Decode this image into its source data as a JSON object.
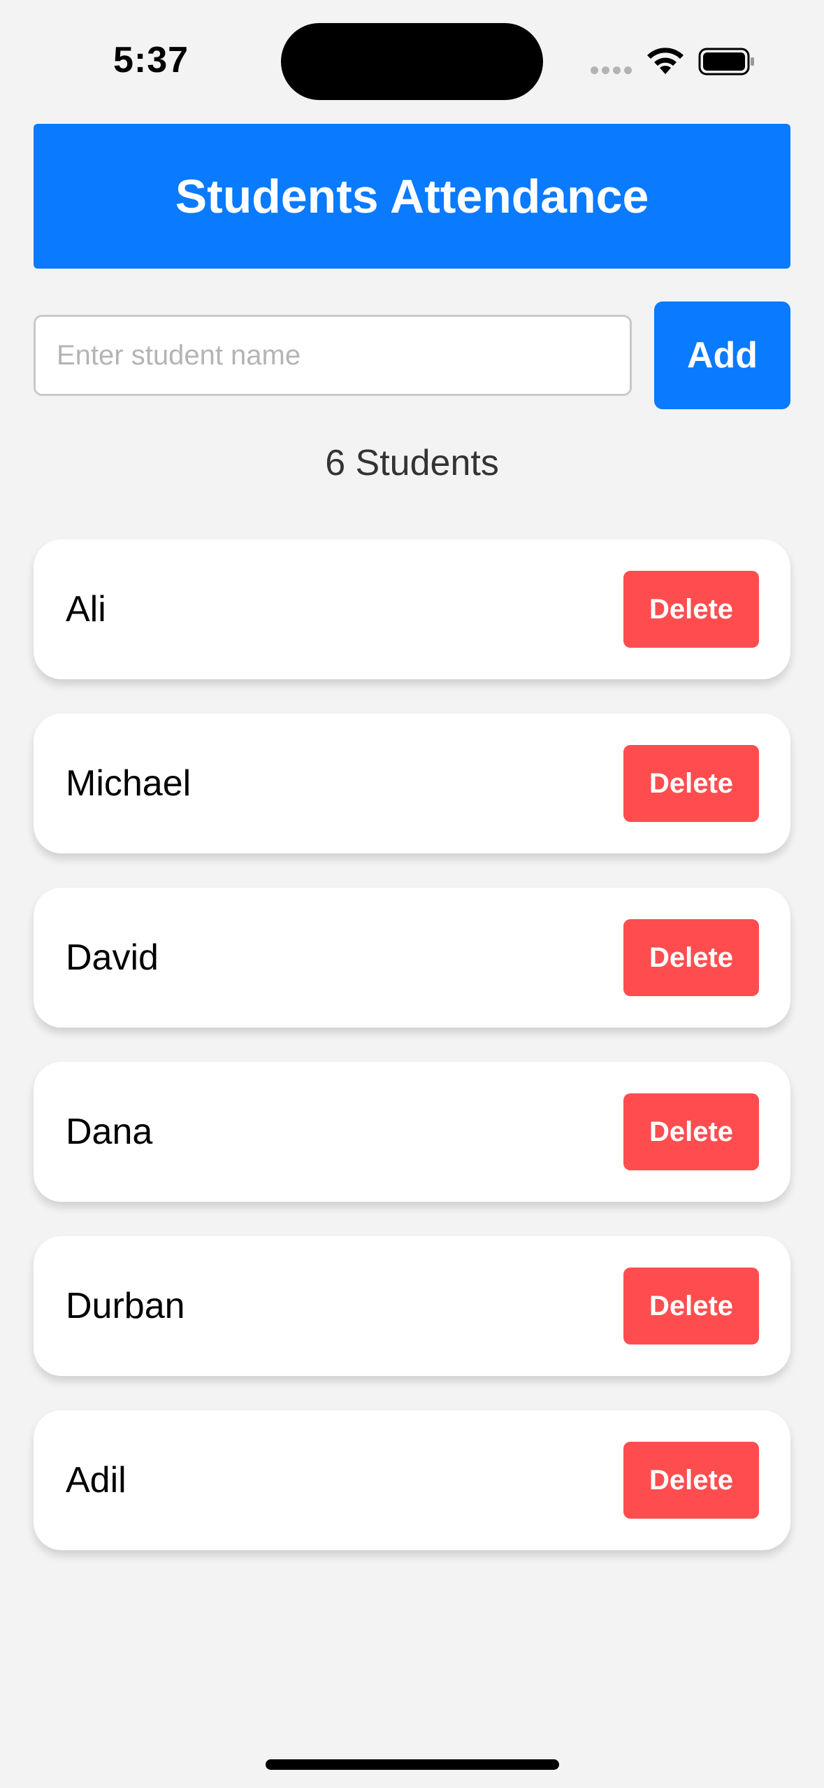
{
  "status_bar": {
    "time": "5:37",
    "icons": [
      "cellular-signal-icon",
      "wifi-icon",
      "battery-icon"
    ]
  },
  "header": {
    "title": "Students Attendance"
  },
  "add_form": {
    "input_value": "",
    "input_placeholder": "Enter student name",
    "add_label": "Add"
  },
  "summary": {
    "count_text": "6 Students"
  },
  "students": [
    {
      "name": "Ali",
      "delete_label": "Delete"
    },
    {
      "name": "Michael",
      "delete_label": "Delete"
    },
    {
      "name": "David",
      "delete_label": "Delete"
    },
    {
      "name": "Dana",
      "delete_label": "Delete"
    },
    {
      "name": "Durban",
      "delete_label": "Delete"
    },
    {
      "name": "Adil",
      "delete_label": "Delete"
    }
  ],
  "colors": {
    "accent": "#0a7afe",
    "delete": "#ff4d4f",
    "background": "#f3f3f3"
  }
}
